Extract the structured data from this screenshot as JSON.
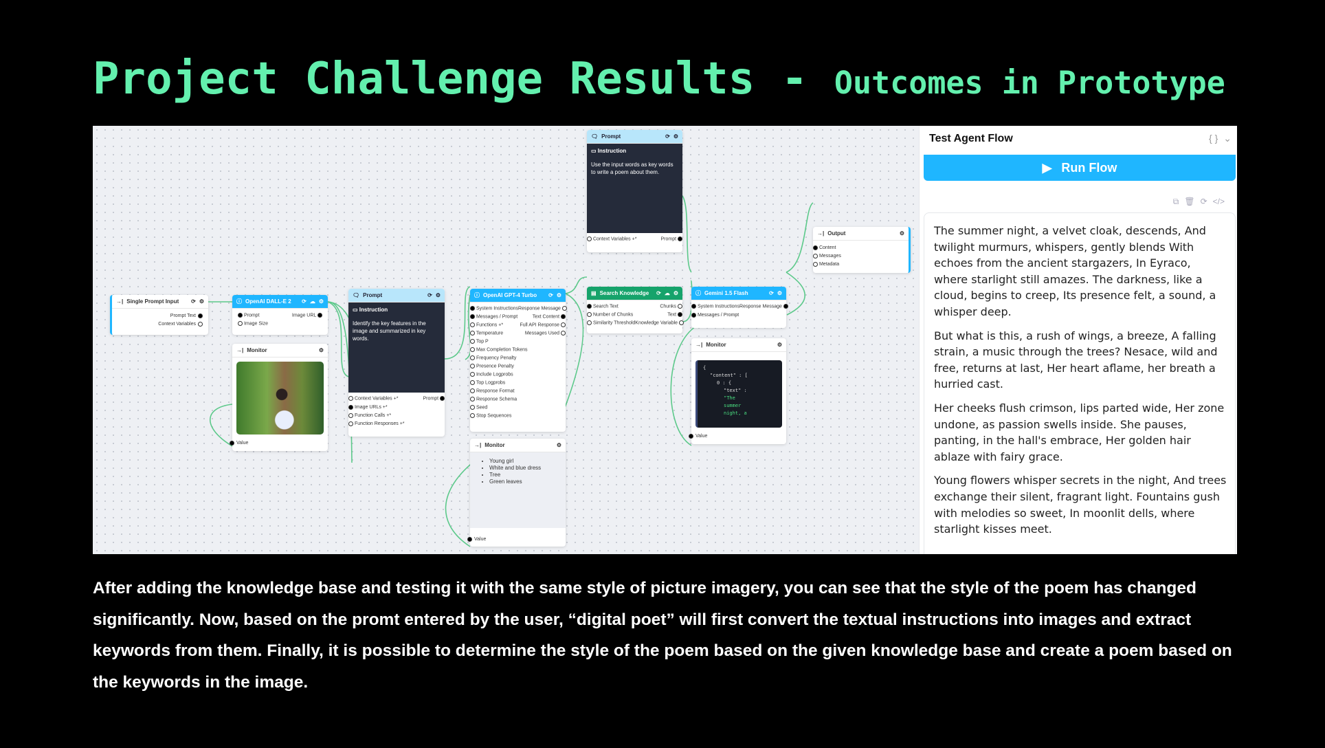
{
  "title": {
    "main": "Project Challenge Results",
    "sep": " - ",
    "sub": "Outcomes in Prototype"
  },
  "nodes": {
    "single_prompt": {
      "title": "Single Prompt Input",
      "outputs": [
        "Prompt Text",
        "Context Variables"
      ]
    },
    "dalle": {
      "title": "OpenAI DALL-E 2",
      "inputs": [
        "Prompt",
        "Image Size"
      ],
      "outputs": [
        "Image URL"
      ]
    },
    "monitor1": {
      "title": "Monitor",
      "port": "Value"
    },
    "prompt1": {
      "title": "Prompt",
      "instruction_label": "Instruction",
      "instruction": "Identify the key features in the image and summarized in key words.",
      "inputs": [
        "Context Variables +*",
        "Image URLs +*",
        "Function Calls +*",
        "Function Responses +*"
      ],
      "output": "Prompt"
    },
    "gpt4": {
      "title": "OpenAI GPT-4 Turbo",
      "inputs": [
        "System Instructions",
        "Messages / Prompt",
        "Functions +*",
        "Temperature",
        "Top P",
        "Max Completion Tokens",
        "Frequency Penalty",
        "Presence Penalty",
        "Include Logprobs",
        "Top Logprobs",
        "Response Format",
        "Response Schema",
        "Seed",
        "Stop Sequences"
      ],
      "outputs": [
        "Response Message",
        "Text Content",
        "Full API Response",
        "Messages Used"
      ]
    },
    "monitor2": {
      "title": "Monitor",
      "items": [
        "Young girl",
        "White and blue dress",
        "Tree",
        "Green leaves"
      ],
      "port": "Value"
    },
    "prompt2": {
      "title": "Prompt",
      "instruction_label": "Instruction",
      "instruction": "Use the input words as key words to write a poem about them.",
      "input": "Context Variables +*",
      "output": "Prompt"
    },
    "search": {
      "title": "Search Knowledge",
      "inputs": [
        "Search Text",
        "Number of Chunks",
        "Similarity Threshold"
      ],
      "outputs": [
        "Chunks",
        "Text",
        "Knowledge Variable"
      ]
    },
    "gemini": {
      "title": "Gemini 1.5 Flash",
      "inputs": [
        "System Instructions",
        "Messages / Prompt"
      ],
      "outputs": [
        "Response Message"
      ]
    },
    "monitor3": {
      "title": "Monitor",
      "json_lines": [
        "{",
        "\"content\" : [",
        "0 : {",
        "\"text\" :",
        "\"The",
        "summer",
        "night, a"
      ],
      "port": "Value"
    },
    "output": {
      "title": "Output",
      "inputs": [
        "Content",
        "Messages",
        "Metadata"
      ]
    }
  },
  "panel": {
    "title": "Test Agent Flow",
    "run_label": "Run Flow",
    "poem": [
      "The summer night, a velvet cloak, descends, And twilight murmurs, whispers, gently blends With echoes from the ancient stargazers, In Eyraco, where starlight still amazes. The darkness, like a cloud, begins to creep, Its presence felt, a sound, a whisper deep.",
      "But what is this, a rush of wings, a breeze, A falling strain, a music through the trees? Nesace, wild and free, returns at last, Her heart aflame, her breath a hurried cast.",
      "Her cheeks flush crimson, lips parted wide, Her zone undone, as passion swells inside. She pauses, panting, in the hall's embrace, Her golden hair ablaze with fairy grace.",
      "Young flowers whisper secrets in the night, And trees exchange their silent, fragrant light. Fountains gush with melodies so sweet, In moonlit dells, where starlight kisses meet."
    ]
  },
  "body": "After adding the knowledge base and testing it with the same style of picture imagery, you can see that the style of the poem has changed significantly. Now, based on the promt entered by the user, “digital poet” will first convert the textual instructions into images and extract keywords from them. Finally, it is possible to determine the style of the poem based on the given knowledge base and create a poem based on the keywords in the image.",
  "colors": {
    "title": "#63f0ae",
    "accent": "#1fb6ff",
    "wire": "#5cc98a",
    "knowledge": "#16a36b"
  }
}
